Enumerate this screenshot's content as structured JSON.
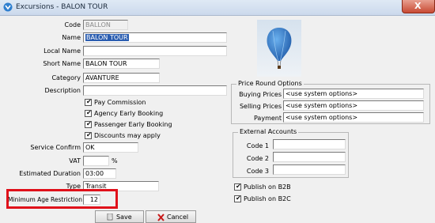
{
  "window": {
    "title": "Excursions - BALON TOUR",
    "close_label": "X"
  },
  "form": {
    "code_label": "Code",
    "code_value": "BALLON",
    "name_label": "Name",
    "name_value": "BALON TOUR",
    "local_name_label": "Local Name",
    "local_name_value": "",
    "short_name_label": "Short Name",
    "short_name_value": "BALON TOUR",
    "category_label": "Category",
    "category_value": "AVANTURE",
    "description_label": "Description",
    "description_value": "",
    "checks": [
      {
        "label": "Pay Commission",
        "checked": true
      },
      {
        "label": "Agency Early Booking",
        "checked": true
      },
      {
        "label": "Passenger Early Booking",
        "checked": true
      },
      {
        "label": "Discounts may apply",
        "checked": true
      }
    ],
    "service_confirm_label": "Service Confirm",
    "service_confirm_value": "OK",
    "vat_label": "VAT",
    "vat_value": "",
    "vat_unit": "%",
    "estimated_duration_label": "Estimated Duration",
    "estimated_duration_value": "03:00",
    "type_label": "Type",
    "type_value": "Transit",
    "min_age_label": "Minimum Age Restriction",
    "min_age_value": "12"
  },
  "price_round": {
    "title": "Price Round Options",
    "buying_label": "Buying Prices",
    "buying_value": "<use system options>",
    "selling_label": "Selling Prices",
    "selling_value": "<use system options>",
    "payment_label": "Payment",
    "payment_value": "<use system options>"
  },
  "external_accounts": {
    "title": "External Accounts",
    "code1_label": "Code 1",
    "code1_value": "",
    "code2_label": "Code 2",
    "code2_value": "",
    "code3_label": "Code 3",
    "code3_value": ""
  },
  "publish": {
    "b2b_label": "Publish on B2B",
    "b2b_checked": true,
    "b2c_label": "Publish on B2C",
    "b2c_checked": true
  },
  "buttons": {
    "save_label": "Save",
    "cancel_label": "Cancel"
  },
  "colors": {
    "highlight": "#e0101a",
    "selection": "#2a5db0",
    "title_gradient_top": "#dfe9f5"
  }
}
